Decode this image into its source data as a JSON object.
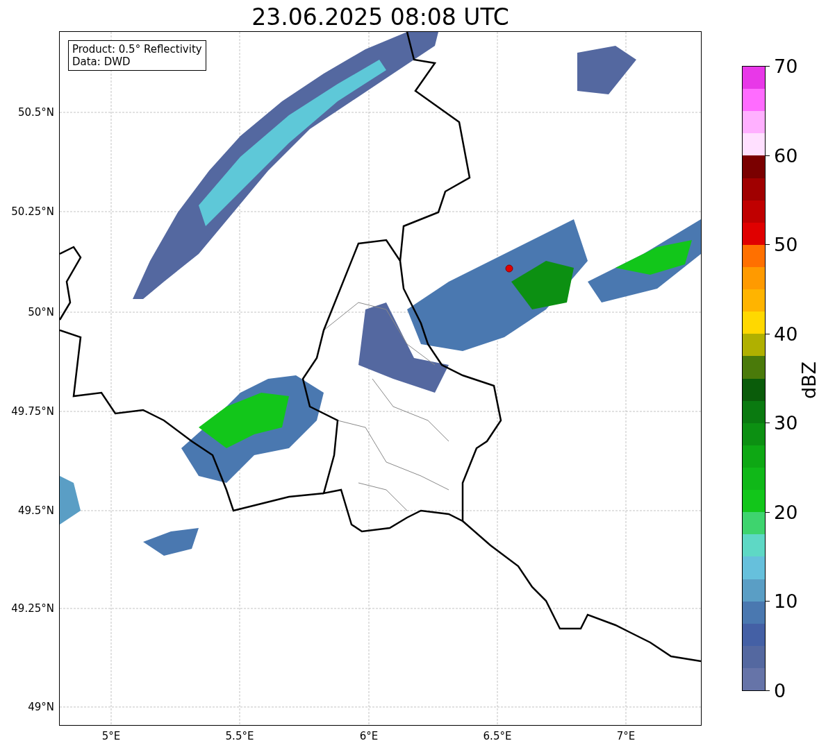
{
  "title": "23.06.2025 08:08 UTC",
  "map": {
    "info_box": [
      "Product: 0.5° Reflectivity",
      "Data: DWD"
    ],
    "y_ticks": [
      "50.5°N",
      "50.25°N",
      "50°N",
      "49.75°N",
      "49.5°N",
      "49.25°N",
      "49°N"
    ],
    "x_ticks": [
      "5°E",
      "5.5°E",
      "6°E",
      "6.5°E",
      "7°E"
    ]
  },
  "colorbar": {
    "label": "dBZ",
    "ticks": [
      "70",
      "60",
      "50",
      "40",
      "30",
      "20",
      "10",
      "0"
    ],
    "bands": [
      {
        "color": "#e838e8"
      },
      {
        "color": "#ff6cff"
      },
      {
        "color": "#ffb0ff"
      },
      {
        "color": "#ffe0ff"
      },
      {
        "color": "#7a0000"
      },
      {
        "color": "#a00000"
      },
      {
        "color": "#c00000"
      },
      {
        "color": "#e00000"
      },
      {
        "color": "#ff7000"
      },
      {
        "color": "#ff9a00"
      },
      {
        "color": "#ffb400"
      },
      {
        "color": "#ffd800"
      },
      {
        "color": "#b0b000"
      },
      {
        "color": "#4a7a0a"
      },
      {
        "color": "#0a5c0a"
      },
      {
        "color": "#0a7a10"
      },
      {
        "color": "#0c9012"
      },
      {
        "color": "#0ea814"
      },
      {
        "color": "#10b818"
      },
      {
        "color": "#12c61a"
      },
      {
        "color": "#3ed46e"
      },
      {
        "color": "#5ed8c5"
      },
      {
        "color": "#66c0dc"
      },
      {
        "color": "#5a9ec5"
      },
      {
        "color": "#4a78b0"
      },
      {
        "color": "#4460a5"
      },
      {
        "color": "#5468a0"
      },
      {
        "color": "#6674a8"
      }
    ]
  }
}
